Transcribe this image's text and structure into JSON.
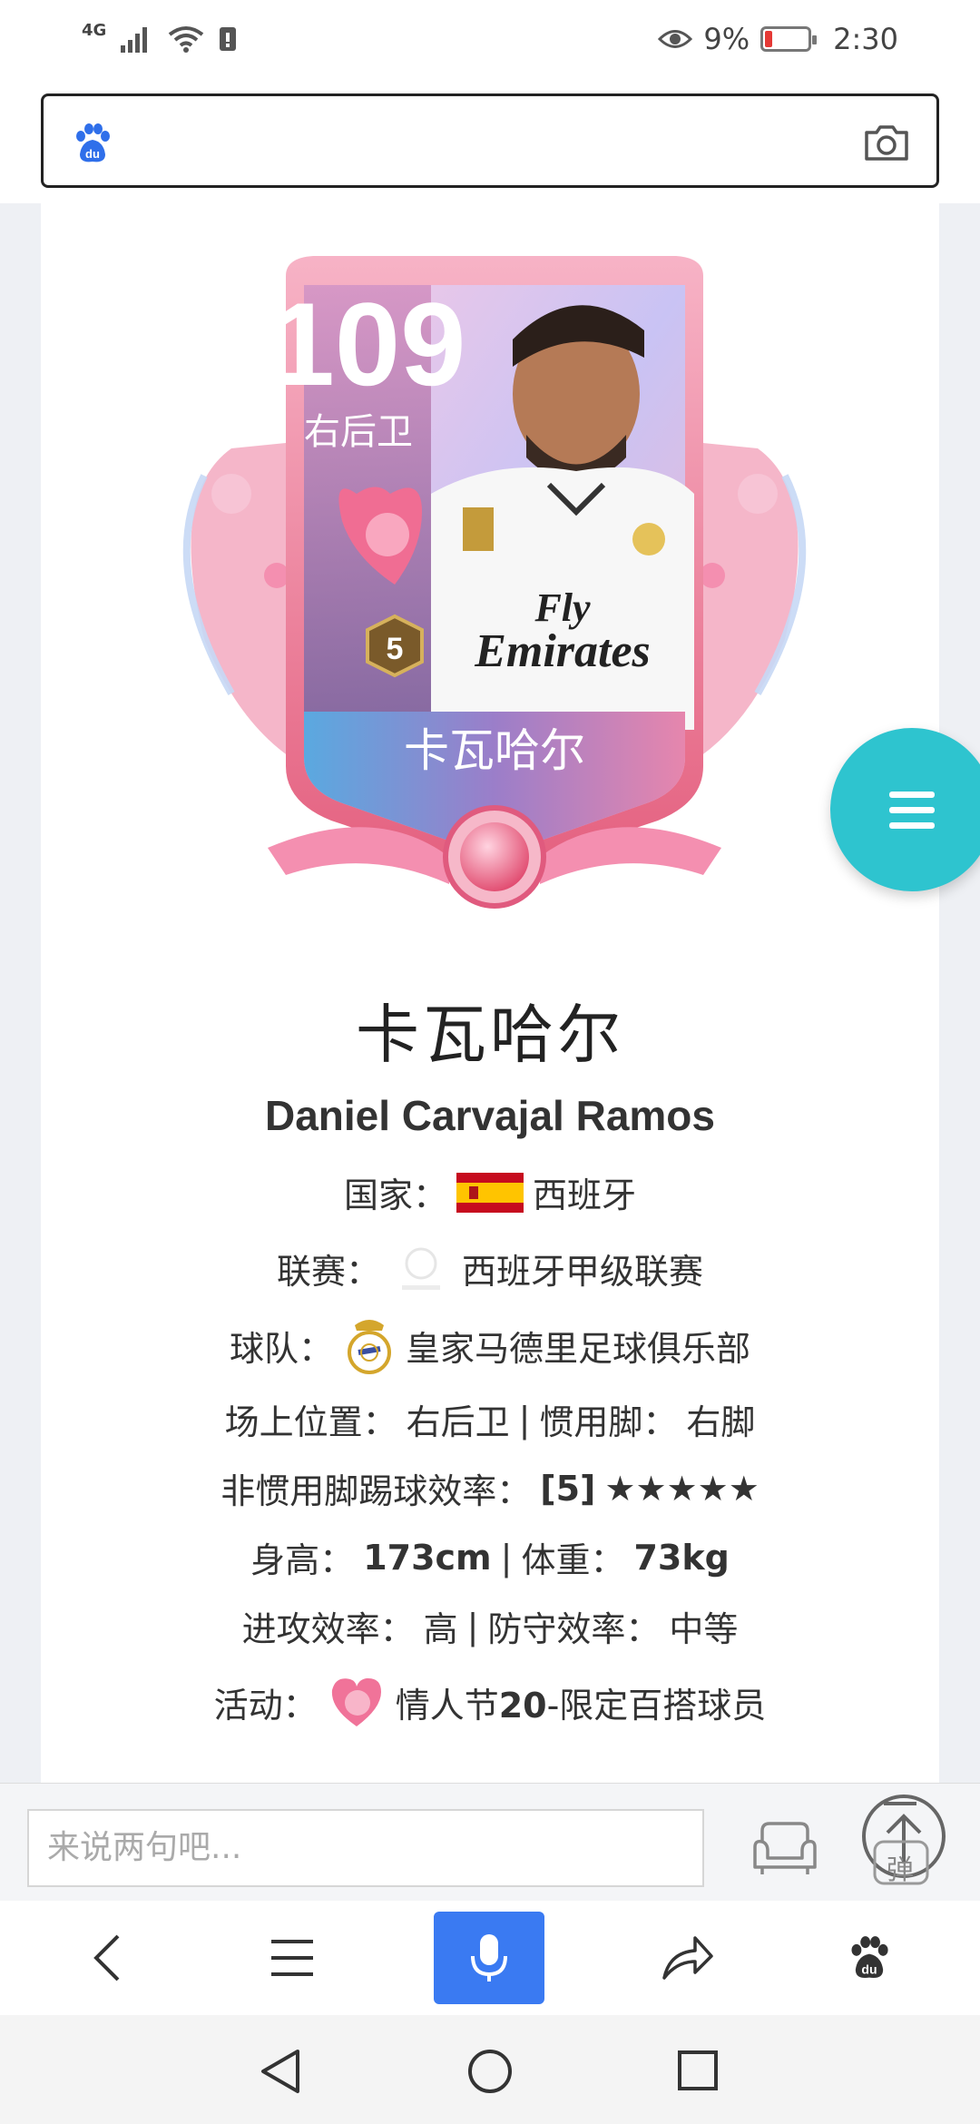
{
  "status_bar": {
    "network": "4G",
    "battery_percent": "9%",
    "time": "2:30",
    "icons": [
      "signal-icon",
      "wifi-icon",
      "sim-icon",
      "eye-icon",
      "battery-icon"
    ]
  },
  "search": {
    "logo": "baidu-paw-icon",
    "placeholder": "",
    "camera_icon": "camera-icon"
  },
  "card": {
    "rating": "109",
    "position_short": "右后卫",
    "tier": "5",
    "name_banner": "卡瓦哈尔",
    "sponsor_line1": "Fly",
    "sponsor_line2": "Emirates"
  },
  "player": {
    "name_cn": "卡瓦哈尔",
    "name_en": "Daniel Carvajal Ramos",
    "country_label": "国家：",
    "country": "西班牙",
    "league_label": "联赛：",
    "league": "西班牙甲级联赛",
    "team_label": "球队：",
    "team": "皇家马德里足球俱乐部",
    "position_label": "场上位置：",
    "position": "右后卫",
    "sep": "|",
    "foot_label": "惯用脚：",
    "foot": "右脚",
    "weakfoot_label": "非惯用脚踢球效率：",
    "weakfoot_value": "[5]",
    "weakfoot_stars": "★★★★★",
    "height_label": "身高：",
    "height": "173cm",
    "weight_label": "体重：",
    "weight": "73kg",
    "attack_label": "进攻效率：",
    "attack": "高",
    "defense_label": "防守效率：",
    "defense": "中等",
    "event_label": "活动：",
    "event_name": "情人节",
    "event_bold": "20",
    "event_rest": "-限定百搭球员"
  },
  "comment": {
    "placeholder": "来说两句吧...",
    "danmu_label": "弹"
  },
  "toolbar": {
    "items": [
      "back-icon",
      "menu-icon",
      "mic-icon",
      "share-icon",
      "baidu-paw-icon"
    ]
  },
  "colors": {
    "accent_fab": "#2ec4cf",
    "mic_button": "#3a7af2",
    "card_pink": "#e98aa6"
  }
}
